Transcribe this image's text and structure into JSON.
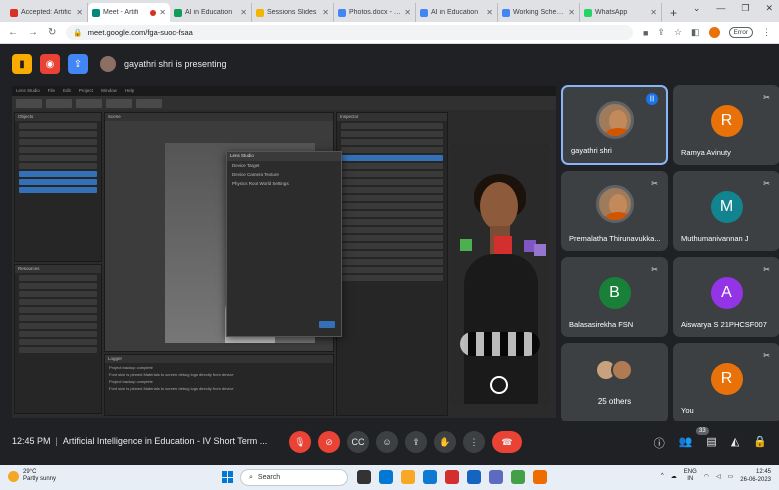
{
  "browser": {
    "tabs": [
      {
        "label": "Accepted: Artific",
        "color": "#d93025",
        "active": false
      },
      {
        "label": "Meet - Artifi",
        "color": "#00897b",
        "active": true,
        "recording": true
      },
      {
        "label": "AI in Education",
        "color": "#0f9d58",
        "active": false
      },
      {
        "label": "Sessions Slides",
        "color": "#f4b400",
        "active": false
      },
      {
        "label": "Photos.docx - Go",
        "color": "#4285f4",
        "active": false
      },
      {
        "label": "AI in Education",
        "color": "#4285f4",
        "active": false
      },
      {
        "label": "Working Schedul",
        "color": "#4285f4",
        "active": false
      },
      {
        "label": "WhatsApp",
        "color": "#25d366",
        "active": false
      }
    ],
    "new_tab": "+",
    "url": "meet.google.com/fga-suoc-fsaa",
    "error_label": "Error"
  },
  "meet": {
    "presenter_text": "gayathri shri is presenting",
    "meeting_time": "12:45 PM",
    "meeting_title": "Artificial Intelligence in Education - IV Short Term ...",
    "participant_badge": "33",
    "participants": [
      {
        "name": "gayathri shri",
        "type": "photo",
        "speaking": true
      },
      {
        "name": "Ramya Avinuty",
        "initial": "R",
        "color": "#e8710a"
      },
      {
        "name": "Premalatha Thirunavukka...",
        "type": "photo2"
      },
      {
        "name": "Muthumanivannan J",
        "initial": "M",
        "color": "#12848f"
      },
      {
        "name": "Balasasirekha FSN",
        "initial": "B",
        "color": "#188038"
      },
      {
        "name": "Aiswarya S 21PHCSF007",
        "initial": "A",
        "color": "#9334e6"
      },
      {
        "name": "25 others",
        "type": "others"
      },
      {
        "name": "You",
        "initial": "R",
        "color": "#e8710a"
      }
    ]
  },
  "lens": {
    "dialog_title": "Lens Studio",
    "dialog_items": [
      "Device Target",
      "Device Camera Texture",
      "Physics Root World Settings"
    ]
  },
  "taskbar": {
    "weather_temp": "29°C",
    "weather_desc": "Partly sunny",
    "search_placeholder": "Search",
    "lang": "ENG",
    "lang_sub": "IN",
    "clock_time": "12:45",
    "clock_date": "26-06-2023"
  }
}
